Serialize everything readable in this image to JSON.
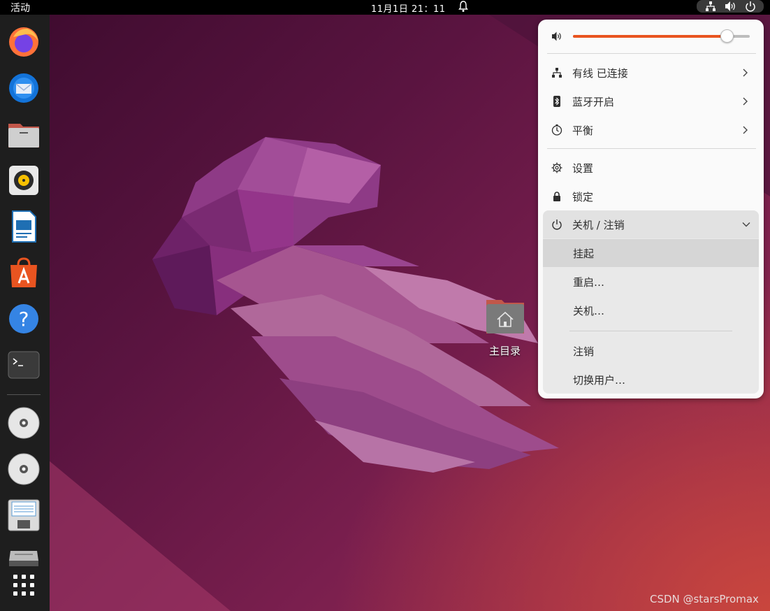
{
  "topbar": {
    "activities": "活动",
    "clock": "11月1日  21：11"
  },
  "desktop": {
    "home_label": "主目录",
    "watermark": "CSDN @starsPromax"
  },
  "dock": {
    "items": [
      "firefox-icon",
      "thunderbird-icon",
      "files-icon",
      "rhythmbox-icon",
      "libreoffice-writer-icon",
      "app-center-icon",
      "help-icon",
      "terminal-icon",
      "disc-icon",
      "disc-icon",
      "floppy-icon",
      "drive-icon",
      "app-grid-icon"
    ]
  },
  "quick_settings": {
    "volume_percent": 87,
    "accent_color": "#e95420",
    "wired": "有线 已连接",
    "bluetooth": "蓝牙开启",
    "power_mode": "平衡",
    "settings": "设置",
    "lock": "锁定",
    "power_menu": {
      "header": "关机 / 注销",
      "suspend": "挂起",
      "restart": "重启…",
      "shutdown": "关机…",
      "logout": "注销",
      "switch_user": "切换用户…"
    }
  }
}
